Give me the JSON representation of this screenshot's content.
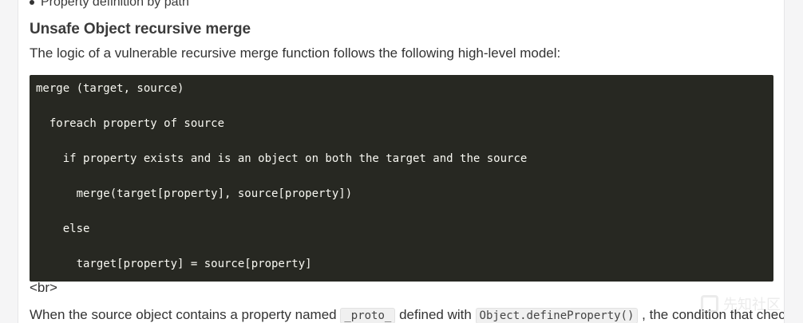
{
  "list": {
    "last_item": "Property definition by path"
  },
  "section": {
    "heading": "Unsafe Object recursive merge",
    "intro": "The logic of a vulnerable recursive merge function follows the following high-level model:"
  },
  "code": {
    "lines": [
      "merge (target, source)",
      "  foreach property of source",
      "    if property exists and is an object on both the target and the source",
      "      merge(target[property], source[property])",
      "    else",
      "      target[property] = source[property]"
    ]
  },
  "br_text": "<br>",
  "paragraph": {
    "part1": "When the source object contains a property named ",
    "code1": "_proto_",
    "part2": " defined with ",
    "code2": "Object.defineProperty()",
    "part3": " , the condition that checks"
  },
  "watermark": {
    "text": "先知社区"
  }
}
